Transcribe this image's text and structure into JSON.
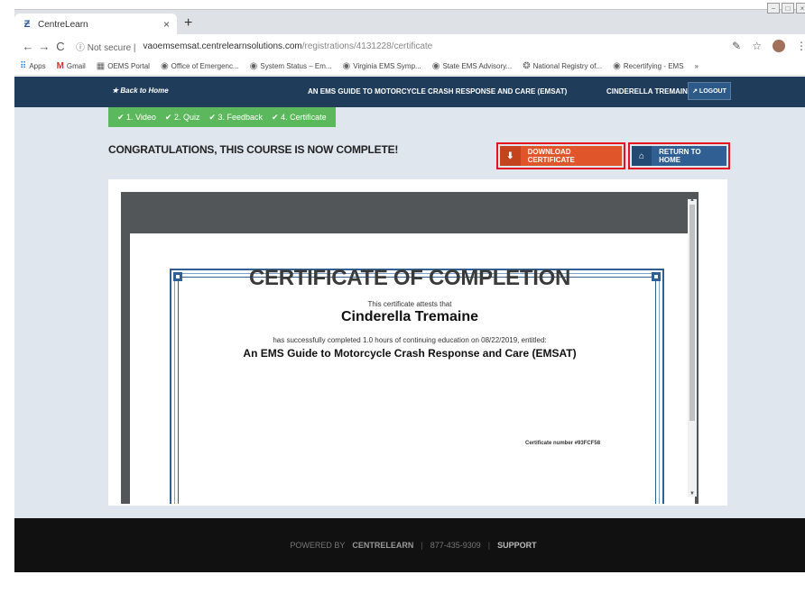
{
  "browser": {
    "tab_title": "CentreLearn",
    "tab_close": "×",
    "new_tab": "+",
    "back": "←",
    "forward": "→",
    "reload": "C",
    "url_info": "ⓘ Not secure |",
    "url_host": "vaoemsemsat.centrelearnsolutions.com",
    "url_path": "/registrations/4131228/certificate",
    "star": "☆",
    "more": "⋮",
    "window_controls": [
      "−",
      "□",
      "×"
    ]
  },
  "bookmarks": [
    {
      "icon": "apps-grid-icon",
      "glyph": "⠿",
      "label": "Apps"
    },
    {
      "icon": "gmail-icon",
      "glyph": "M",
      "label": "Gmail"
    },
    {
      "icon": "portal-icon",
      "glyph": "▦",
      "label": "OEMS Portal"
    },
    {
      "icon": "globe-icon",
      "glyph": "◉",
      "label": "Office of Emergenc..."
    },
    {
      "icon": "globe-icon",
      "glyph": "◉",
      "label": "System Status – Em..."
    },
    {
      "icon": "globe-icon",
      "glyph": "◉",
      "label": "Virginia EMS Symp..."
    },
    {
      "icon": "globe-icon",
      "glyph": "◉",
      "label": "State EMS Advisory..."
    },
    {
      "icon": "registry-icon",
      "glyph": "❂",
      "label": "National Registry of..."
    },
    {
      "icon": "globe-icon",
      "glyph": "◉",
      "label": "Recertifying - EMS"
    }
  ],
  "bookmarks_more": "»",
  "header": {
    "back_home": "★ Back to Home",
    "course_title": "AN EMS GUIDE TO MOTORCYCLE CRASH RESPONSE AND CARE (EMSAT)",
    "username": "CINDERELLA TREMAINE",
    "logout": "↗ LOGOUT"
  },
  "steps": [
    "✔ 1. Video",
    "✔ 2. Quiz",
    "✔ 3. Feedback",
    "✔ 4. Certificate"
  ],
  "main": {
    "congrats": "CONGRATULATIONS, THIS COURSE IS NOW COMPLETE!",
    "download_label": "DOWNLOAD CERTIFICATE",
    "download_icon": "⬇",
    "home_label": "RETURN TO HOME",
    "home_icon": "⌂"
  },
  "certificate": {
    "title": "CERTIFICATE OF COMPLETION",
    "attests": "This certificate attests that",
    "recipient": "Cinderella Tremaine",
    "completed": "has successfully completed 1.0 hours of continuing education on 08/22/2019, entitled:",
    "course": "An EMS Guide to Motorcycle Crash Response and Care (EMSAT)",
    "cert_number": "Certificate number #93FCF58"
  },
  "footer": {
    "powered": "POWERED BY",
    "brand": "CENTRELEARN",
    "sep1": "|",
    "phone": "877-435-9309",
    "sep2": "|",
    "support": "SUPPORT"
  },
  "colors": {
    "header_bg": "#1f3c5a",
    "steps_bg": "#5cb85c",
    "download_bg": "#e0562a",
    "home_bg": "#2f5f93",
    "highlight_border": "#e2131d",
    "cert_border": "#2f5f93"
  }
}
